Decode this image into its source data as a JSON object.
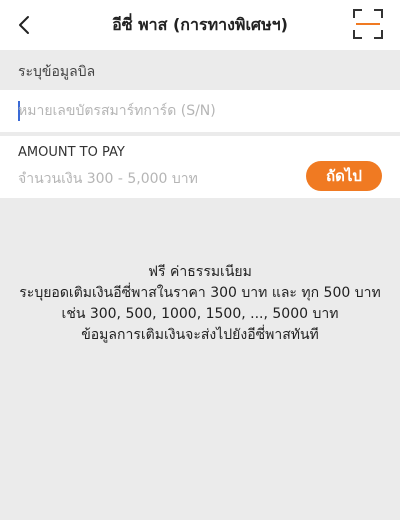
{
  "header": {
    "title": "อีซี่ พาส (การทางพิเศษฯ)",
    "back_icon": "chevron-left-icon",
    "scan_icon": "scan-frame-icon",
    "accent_color": "#f07a22"
  },
  "bill": {
    "section_label": "ระบุข้อมูลบิล",
    "card_placeholder": "หมายเลขบัตรสมาร์ทการ์ด (S/N)",
    "card_value": ""
  },
  "amount": {
    "label": "AMOUNT TO PAY",
    "placeholder": "จำนวนเงิน 300 - 5,000 บาท",
    "value": "",
    "next_label": "ถัดไป"
  },
  "info": {
    "lines": [
      "ฟรี ค่าธรรมเนียม",
      "ระบุยอดเติมเงินอีซี่พาสในราคา 300 บาท และ ทุก 500 บาท",
      "เช่น 300, 500, 1000, 1500, ..., 5000 บาท",
      "ข้อมูลการเติมเงินจะส่งไปยังอีซี่พาสทันที"
    ]
  }
}
